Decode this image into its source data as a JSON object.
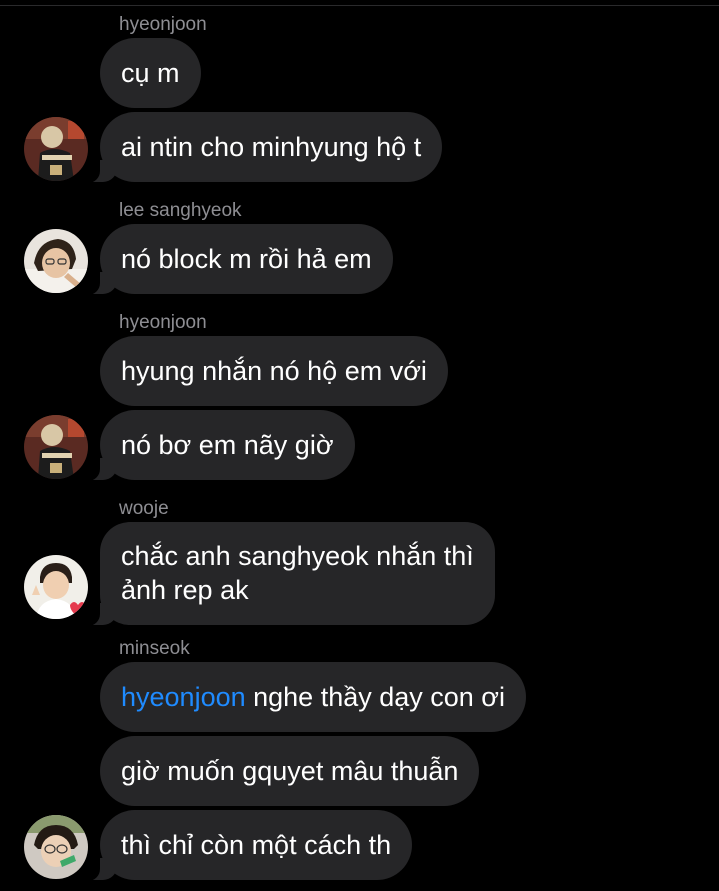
{
  "colors": {
    "background": "#000000",
    "bubble": "#262628",
    "sender_text": "#8e8e93",
    "message_text": "#ffffff",
    "mention": "#1f8bff"
  },
  "messages": [
    {
      "sender": "hyeonjoon",
      "text": "cụ m"
    },
    {
      "text": "ai ntin cho minhyung hộ t",
      "avatar": "hyeonjoon-avatar"
    },
    {
      "sender": "lee sanghyeok",
      "text": "nó block m rồi hả em",
      "avatar": "lee-sanghyeok-avatar"
    },
    {
      "sender": "hyeonjoon",
      "text": "hyung nhắn nó hộ em với"
    },
    {
      "text": "nó bơ em nãy giờ",
      "avatar": "hyeonjoon-avatar"
    },
    {
      "sender": "wooje",
      "line1": "chắc anh sanghyeok nhắn thì",
      "line2": "ảnh rep ak",
      "avatar": "wooje-avatar"
    },
    {
      "sender": "minseok",
      "mention": "hyeonjoon",
      "text": " nghe thầy dạy con ơi"
    },
    {
      "text": "giờ muốn gquyet mâu thuẫn"
    },
    {
      "text": "thì chỉ còn một cách th",
      "avatar": "minseok-avatar"
    }
  ]
}
